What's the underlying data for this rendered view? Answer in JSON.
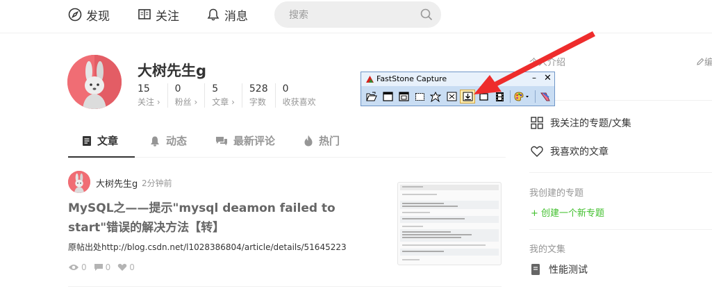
{
  "nav": {
    "discover": "发现",
    "follow": "关注",
    "messages": "消息",
    "search_placeholder": "搜索"
  },
  "profile": {
    "name": "大树先生g",
    "stats": [
      {
        "value": "15",
        "label": "关注 ›"
      },
      {
        "value": "0",
        "label": "粉丝 ›"
      },
      {
        "value": "5",
        "label": "文章 ›"
      },
      {
        "value": "528",
        "label": "字数"
      },
      {
        "value": "0",
        "label": "收获喜欢"
      }
    ]
  },
  "tabs": [
    {
      "label": "文章",
      "icon": "article-icon"
    },
    {
      "label": "动态",
      "icon": "bell-icon"
    },
    {
      "label": "最新评论",
      "icon": "comment-icon"
    },
    {
      "label": "热门",
      "icon": "fire-icon"
    }
  ],
  "article": {
    "author": "大树先生g",
    "time": "2分钟前",
    "title": "MySQL之——提示\"mysql deamon failed to start\"错误的解决方法【转】",
    "abstract": "原帖出处http://blog.csdn.net/l1028386804/article/details/51645223",
    "views": "0",
    "comments": "0",
    "likes": "0"
  },
  "sidebar": {
    "intro": "个人介绍",
    "edit": "编",
    "subscribed": "我关注的专题/文集",
    "liked": "我喜欢的文章",
    "my_topics": "我创建的专题",
    "create_topic": "+ 创建一个新专题",
    "my_collections": "我的文集",
    "collection_name": "性能测试"
  },
  "faststone": {
    "title": "FastStone Capture",
    "minimize": "–",
    "close": "✕"
  },
  "colors": {
    "brand_red": "#f06d74",
    "accent_arrow": "#ee2c2c",
    "green": "#42c02e"
  }
}
